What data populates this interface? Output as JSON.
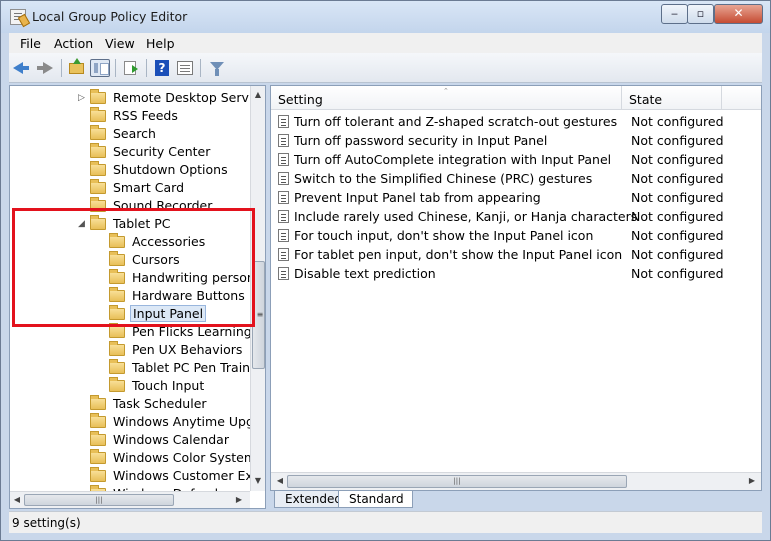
{
  "window": {
    "title": "Local Group Policy Editor",
    "minimize_glyph": "‒",
    "maximize_glyph": "▫",
    "close_glyph": "✕"
  },
  "menu": [
    {
      "label": "File"
    },
    {
      "label": "Action"
    },
    {
      "label": "View"
    },
    {
      "label": "Help"
    }
  ],
  "toolbar": {
    "help_glyph": "?"
  },
  "tree": [
    {
      "label": "Remote Desktop Services",
      "expander": "▷",
      "level": 0
    },
    {
      "label": "RSS Feeds",
      "expander": "",
      "level": 0
    },
    {
      "label": "Search",
      "expander": "",
      "level": 0
    },
    {
      "label": "Security Center",
      "expander": "",
      "level": 0
    },
    {
      "label": "Shutdown Options",
      "expander": "",
      "level": 0
    },
    {
      "label": "Smart Card",
      "expander": "",
      "level": 0
    },
    {
      "label": "Sound Recorder",
      "expander": "",
      "level": 0
    },
    {
      "label": "Tablet PC",
      "expander": "◢",
      "level": 0
    },
    {
      "label": "Accessories",
      "expander": "",
      "level": 1
    },
    {
      "label": "Cursors",
      "expander": "",
      "level": 1
    },
    {
      "label": "Handwriting personalization",
      "expander": "",
      "level": 1
    },
    {
      "label": "Hardware Buttons",
      "expander": "",
      "level": 1
    },
    {
      "label": "Input Panel",
      "expander": "",
      "level": 1,
      "selected": true
    },
    {
      "label": "Pen Flicks Learning",
      "expander": "",
      "level": 1
    },
    {
      "label": "Pen UX Behaviors",
      "expander": "",
      "level": 1
    },
    {
      "label": "Tablet PC Pen Training",
      "expander": "",
      "level": 1
    },
    {
      "label": "Touch Input",
      "expander": "",
      "level": 1
    },
    {
      "label": "Task Scheduler",
      "expander": "",
      "level": 0
    },
    {
      "label": "Windows Anytime Upgrade",
      "expander": "",
      "level": 0
    },
    {
      "label": "Windows Calendar",
      "expander": "",
      "level": 0
    },
    {
      "label": "Windows Color System",
      "expander": "",
      "level": 0
    },
    {
      "label": "Windows Customer Experience Improvement Program",
      "expander": "",
      "level": 0
    },
    {
      "label": "Windows Defender",
      "expander": "",
      "level": 0
    }
  ],
  "scroll_glyphs": {
    "up": "▲",
    "down": "▼",
    "left": "◀",
    "right": "▶",
    "grip": "|||",
    "vgrip": "≡"
  },
  "list": {
    "columns": {
      "setting": "Setting",
      "state": "State"
    },
    "sort_glyph": "⌃",
    "rows": [
      {
        "setting": "Turn off tolerant and Z-shaped scratch-out gestures",
        "state": "Not configured"
      },
      {
        "setting": "Turn off password security in Input Panel",
        "state": "Not configured"
      },
      {
        "setting": "Turn off AutoComplete integration with Input Panel",
        "state": "Not configured"
      },
      {
        "setting": "Switch to the Simplified Chinese (PRC) gestures",
        "state": "Not configured"
      },
      {
        "setting": "Prevent Input Panel tab from appearing",
        "state": "Not configured"
      },
      {
        "setting": "Include rarely used Chinese, Kanji, or Hanja characters",
        "state": "Not configured"
      },
      {
        "setting": "For touch input, don't show the Input Panel icon",
        "state": "Not configured"
      },
      {
        "setting": "For tablet pen input, don't show the Input Panel icon",
        "state": "Not configured"
      },
      {
        "setting": "Disable text prediction",
        "state": "Not configured"
      }
    ]
  },
  "tabs": [
    {
      "label": "Extended",
      "active": false
    },
    {
      "label": "Standard",
      "active": true
    }
  ],
  "status": {
    "text": "9 setting(s)"
  },
  "colors": {
    "highlight_box": "#e3121d",
    "selection": "#dce8f6"
  }
}
